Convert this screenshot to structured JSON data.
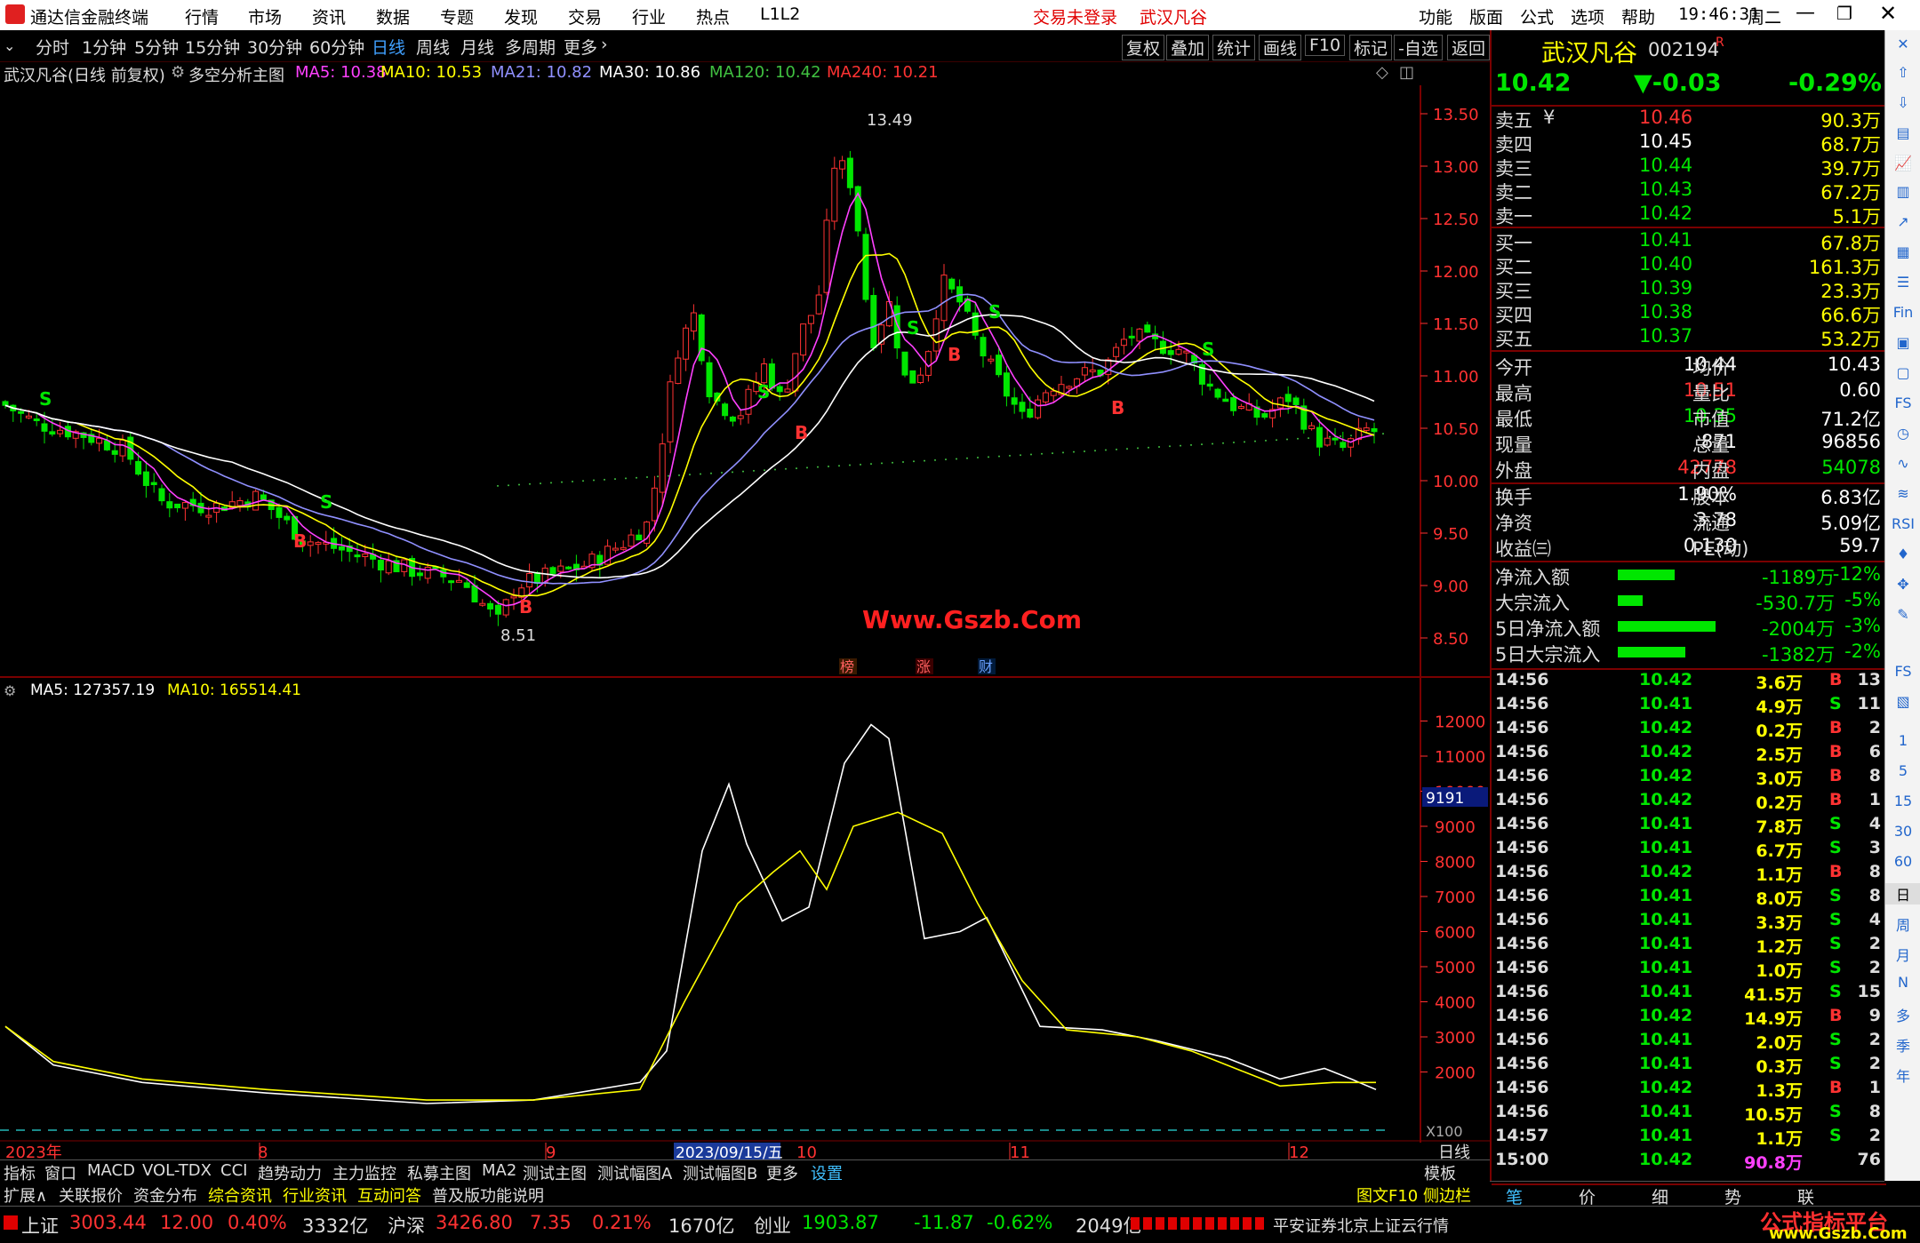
{
  "titlebar": {
    "app_name": "通达信金融终端",
    "menu": [
      "行情",
      "市场",
      "资讯",
      "数据",
      "专题",
      "发现",
      "交易",
      "行业",
      "热点",
      "L1L2"
    ],
    "login_status": "交易未登录",
    "stock_name": "武汉凡谷",
    "right_menu": [
      "功能",
      "版面",
      "公式",
      "选项",
      "帮助"
    ],
    "time": "19:46:31",
    "weekday": "周二"
  },
  "toolbar": {
    "periods": [
      "分时",
      "1分钟",
      "5分钟",
      "15分钟",
      "30分钟",
      "60分钟",
      "日线",
      "周线",
      "月线",
      "多周期",
      "更多"
    ],
    "active_period": "日线",
    "actions": [
      "复权",
      "叠加",
      "统计",
      "画线",
      "F10",
      "标记",
      "-自选",
      "返回"
    ]
  },
  "chart_info": {
    "stock": "武汉凡谷(日线 前复权)",
    "indicator": "多空分析主图",
    "ma5": "MA5: 10.38",
    "ma10": "MA10: 10.53",
    "ma21": "MA21: 10.82",
    "ma30": "MA30: 10.86",
    "ma120": "MA120: 10.42",
    "ma240": "MA240: 10.21",
    "high_label": "13.49",
    "low_label": "8.51",
    "watermark": "Www.Gszb.Com",
    "markers": [
      "榜",
      "涨",
      "财"
    ]
  },
  "price_axis": [
    "13.50",
    "13.00",
    "12.50",
    "12.00",
    "11.50",
    "11.00",
    "10.50",
    "10.00",
    "9.50",
    "9.00",
    "8.50"
  ],
  "volume_info": {
    "ma5": "MA5: 127357.19",
    "ma10": "MA10: 165514.41",
    "current": "9191",
    "unit": "X100"
  },
  "volume_axis": [
    "12000",
    "11000",
    "10000",
    "9000",
    "8000",
    "7000",
    "6000",
    "5000",
    "4000",
    "3000",
    "2000"
  ],
  "date_axis": {
    "labels": [
      "2023年",
      "8",
      "9",
      "2023/09/15/五",
      "10",
      "11",
      "12"
    ],
    "right": "日线"
  },
  "bottom_tabs": [
    "指标",
    "窗口",
    "MACD",
    "VOL-TDX",
    "CCI",
    "趋势动力",
    "主力监控",
    "私募主图",
    "MA2",
    "测试主图",
    "测试幅图A",
    "测试幅图B",
    "更多",
    "设置"
  ],
  "bottom_tab_right": "模板",
  "info_tabs": [
    "扩展∧",
    "关联报价",
    "资金分布",
    "综合资讯",
    "行业资讯",
    "互动问答",
    "普及版功能说明"
  ],
  "info_tab_right": "图文F10 侧边栏 《",
  "quote": {
    "name": "武汉凡谷",
    "code": "002194",
    "flag": "R",
    "price": "10.42",
    "change": "▼-0.03",
    "pct": "-0.29%",
    "sell": [
      {
        "label": "卖五",
        "price": "10.46",
        "vol": "90.3万",
        "extra": "¥"
      },
      {
        "label": "卖四",
        "price": "10.45",
        "vol": "68.7万"
      },
      {
        "label": "卖三",
        "price": "10.44",
        "vol": "39.7万"
      },
      {
        "label": "卖二",
        "price": "10.43",
        "vol": "67.2万"
      },
      {
        "label": "卖一",
        "price": "10.42",
        "vol": "5.1万"
      }
    ],
    "buy": [
      {
        "label": "买一",
        "price": "10.41",
        "vol": "67.8万"
      },
      {
        "label": "买二",
        "price": "10.40",
        "vol": "161.3万"
      },
      {
        "label": "买三",
        "price": "10.39",
        "vol": "23.3万"
      },
      {
        "label": "买四",
        "price": "10.38",
        "vol": "66.6万"
      },
      {
        "label": "买五",
        "price": "10.37",
        "vol": "53.2万"
      }
    ],
    "stats": [
      {
        "l1": "今开",
        "v1": "10.44",
        "l2": "均价",
        "v2": "10.43"
      },
      {
        "l1": "最高",
        "v1": "10.51",
        "l2": "量比",
        "v2": "0.60"
      },
      {
        "l1": "最低",
        "v1": "10.35",
        "l2": "市值",
        "v2": "71.2亿"
      },
      {
        "l1": "现量",
        "v1": "871",
        "l2": "总量",
        "v2": "96856"
      },
      {
        "l1": "外盘",
        "v1": "42778",
        "l2": "内盘",
        "v2": "54078"
      }
    ],
    "stats2": [
      {
        "l1": "换手",
        "v1": "1.90%",
        "l2": "股本",
        "v2": "6.83亿"
      },
      {
        "l1": "净资",
        "v1": "3.78",
        "l2": "流通",
        "v2": "5.09亿"
      },
      {
        "l1": "收益㈢",
        "v1": "0.130",
        "l2": "PE(动)",
        "v2": "59.7"
      }
    ],
    "flows": [
      {
        "label": "净流入额",
        "bar": 0.32,
        "value": "-1189万",
        "pct": "-12%"
      },
      {
        "label": "大宗流入",
        "bar": 0.14,
        "value": "-530.7万",
        "pct": "-5%"
      },
      {
        "label": "5日净流入额",
        "bar": 0.55,
        "value": "-2004万",
        "pct": "-3%"
      },
      {
        "label": "5日大宗流入",
        "bar": 0.38,
        "value": "-1382万",
        "pct": "-2%"
      }
    ]
  },
  "ticks": [
    {
      "t": "14:56",
      "p": "10.42",
      "v": "3.6万",
      "s": "B",
      "n": "13"
    },
    {
      "t": "14:56",
      "p": "10.41",
      "v": "4.9万",
      "s": "S",
      "n": "11"
    },
    {
      "t": "14:56",
      "p": "10.42",
      "v": "0.2万",
      "s": "B",
      "n": "2"
    },
    {
      "t": "14:56",
      "p": "10.42",
      "v": "2.5万",
      "s": "B",
      "n": "6"
    },
    {
      "t": "14:56",
      "p": "10.42",
      "v": "3.0万",
      "s": "B",
      "n": "8"
    },
    {
      "t": "14:56",
      "p": "10.42",
      "v": "0.2万",
      "s": "B",
      "n": "1"
    },
    {
      "t": "14:56",
      "p": "10.41",
      "v": "7.8万",
      "s": "S",
      "n": "4"
    },
    {
      "t": "14:56",
      "p": "10.41",
      "v": "6.7万",
      "s": "S",
      "n": "3"
    },
    {
      "t": "14:56",
      "p": "10.42",
      "v": "1.1万",
      "s": "B",
      "n": "8"
    },
    {
      "t": "14:56",
      "p": "10.41",
      "v": "8.0万",
      "s": "S",
      "n": "8"
    },
    {
      "t": "14:56",
      "p": "10.41",
      "v": "3.3万",
      "s": "S",
      "n": "4"
    },
    {
      "t": "14:56",
      "p": "10.41",
      "v": "1.2万",
      "s": "S",
      "n": "2"
    },
    {
      "t": "14:56",
      "p": "10.41",
      "v": "1.0万",
      "s": "S",
      "n": "2"
    },
    {
      "t": "14:56",
      "p": "10.41",
      "v": "41.5万",
      "s": "S",
      "n": "15"
    },
    {
      "t": "14:56",
      "p": "10.42",
      "v": "14.9万",
      "s": "B",
      "n": "9"
    },
    {
      "t": "14:56",
      "p": "10.41",
      "v": "2.0万",
      "s": "S",
      "n": "2"
    },
    {
      "t": "14:56",
      "p": "10.41",
      "v": "0.3万",
      "s": "S",
      "n": "2"
    },
    {
      "t": "14:56",
      "p": "10.42",
      "v": "1.3万",
      "s": "B",
      "n": "1"
    },
    {
      "t": "14:56",
      "p": "10.41",
      "v": "10.5万",
      "s": "S",
      "n": "8"
    },
    {
      "t": "14:57",
      "p": "10.41",
      "v": "1.1万",
      "s": "S",
      "n": "2"
    },
    {
      "t": "15:00",
      "p": "10.42",
      "v": "90.8万",
      "s": "",
      "n": "76"
    }
  ],
  "right_tabs": [
    "笔",
    "价",
    "细",
    "势",
    "联"
  ],
  "sidebar_labels": [
    "1",
    "5",
    "15",
    "30",
    "60",
    "日",
    "周",
    "月",
    "N",
    "多",
    "季",
    "年"
  ],
  "status": {
    "sh_name": "上证",
    "sh_val": "3003.44",
    "sh_chg": "12.00",
    "sh_pct": "0.40%",
    "sh_amt": "3332亿",
    "sz_name": "沪深",
    "sz_val": "3426.80",
    "sz_chg": "7.35",
    "sz_pct": "0.21%",
    "sz_amt": "1670亿",
    "cy_name": "创业",
    "cy_val": "1903.87",
    "cy_chg": "-11.87",
    "cy_pct": "-0.62%",
    "cy_amt": "2049亿",
    "broker": "平安证券北京上证云行情",
    "brand": "公式指标平台",
    "brand_url": "www.Gszb.Com"
  },
  "colors": {
    "up": "#ff3232",
    "down": "#00e600",
    "ma5": "#ff40ff",
    "ma10": "#ffff00",
    "ma21": "#9090ff",
    "ma30": "#ffffff",
    "ma120": "#40c040",
    "ma240": "#ff3232"
  }
}
